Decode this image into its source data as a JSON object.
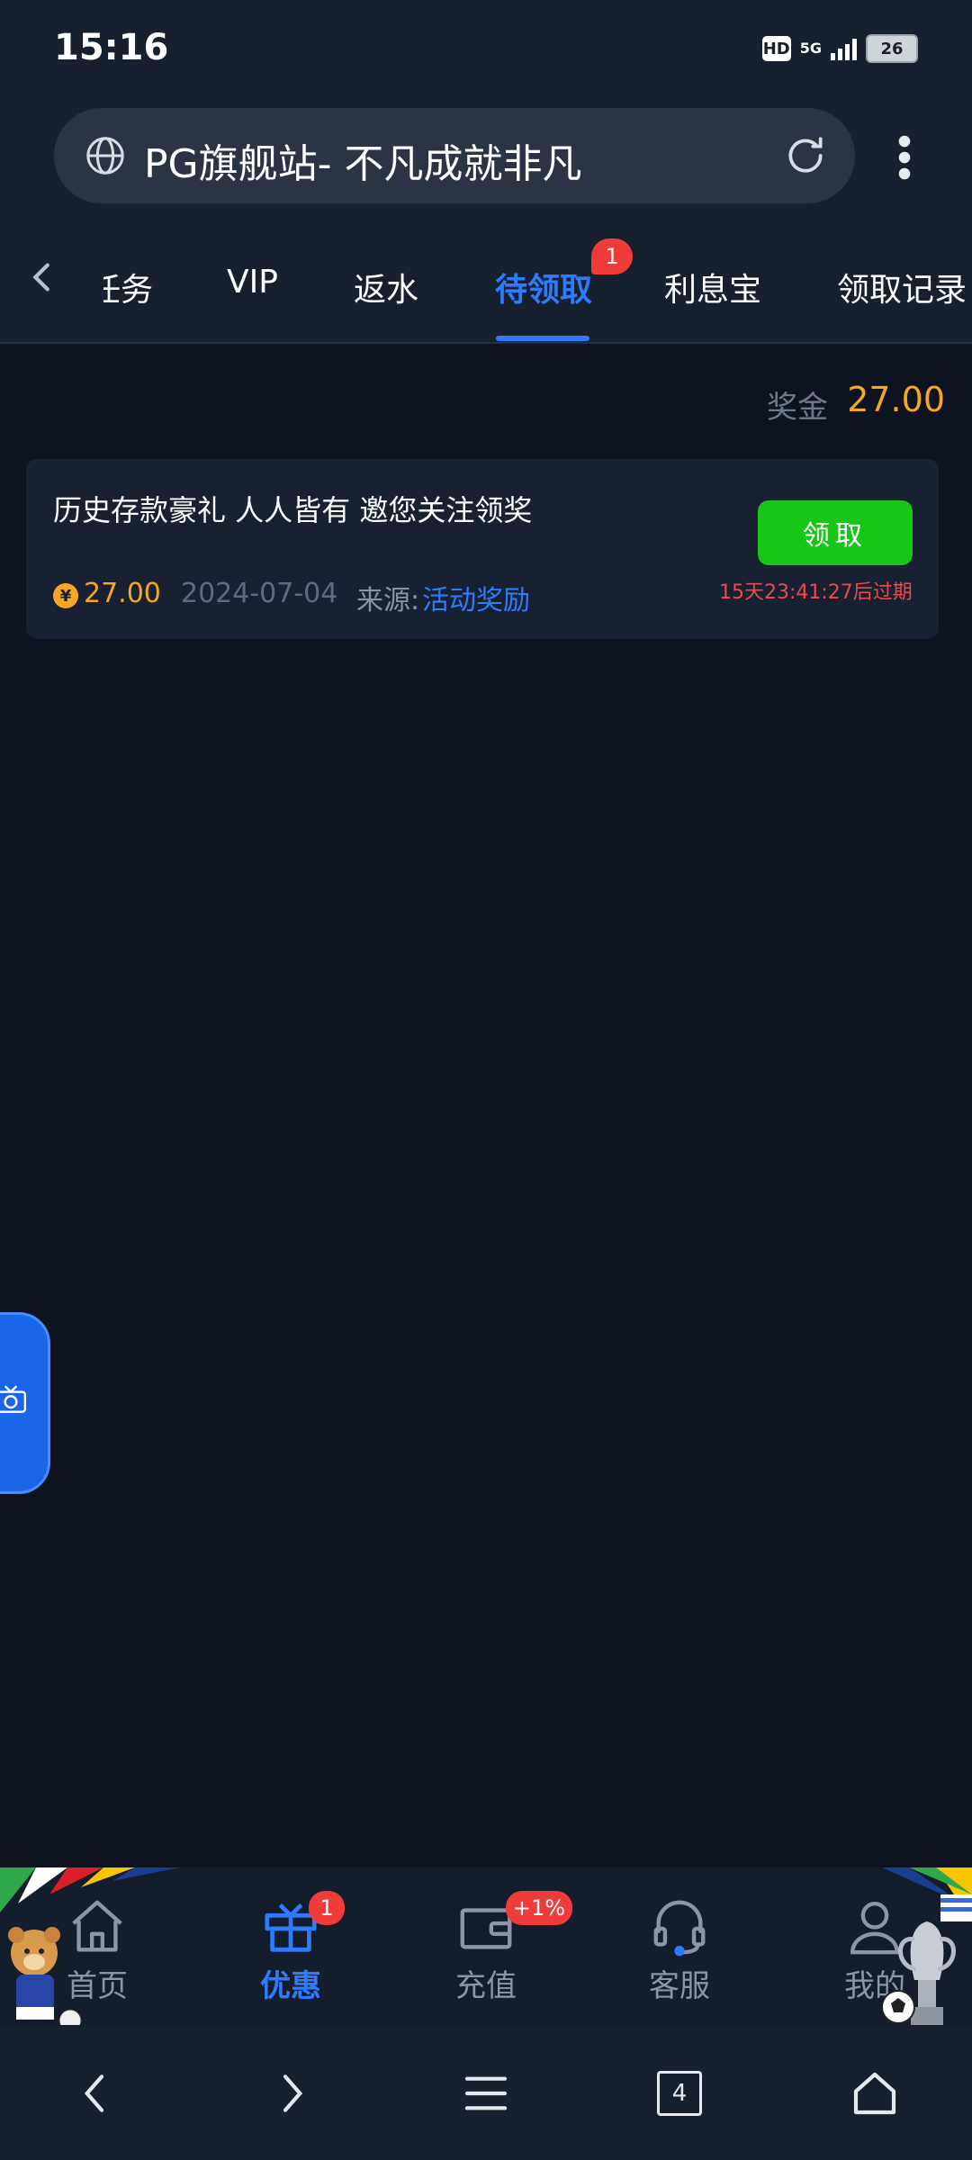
{
  "status": {
    "time": "15:16",
    "hd": "HD",
    "network": "5G",
    "battery": "26"
  },
  "browser": {
    "title": "PG旗舰站- 不凡成就非凡"
  },
  "tabs": [
    {
      "label": "任务"
    },
    {
      "label": "VIP"
    },
    {
      "label": "返水"
    },
    {
      "label": "待领取",
      "active": true,
      "badge": "1"
    },
    {
      "label": "利息宝"
    },
    {
      "label": "领取记录"
    }
  ],
  "bonus": {
    "label": "奖金",
    "value": "27.00"
  },
  "reward_card": {
    "title": "历史存款豪礼 人人皆有 邀您关注领奖",
    "button": "领取",
    "expire": "15天23:41:27后过期",
    "currency_symbol": "¥",
    "amount": "27.00",
    "date": "2024-07-04",
    "source_label": "来源:",
    "source_value": "活动奖励"
  },
  "bottom_nav": [
    {
      "label": "首页",
      "icon": "home-icon"
    },
    {
      "label": "优惠",
      "icon": "gift-icon",
      "active": true,
      "badge": "1"
    },
    {
      "label": "充值",
      "icon": "wallet-icon",
      "badge": "+1%"
    },
    {
      "label": "客服",
      "icon": "headset-icon"
    },
    {
      "label": "我的",
      "icon": "user-icon"
    }
  ],
  "system_nav": {
    "tab_count": "4"
  },
  "colors": {
    "accent": "#2f7bff",
    "gold": "#f5a623",
    "claim_green": "#17c617",
    "badge_red": "#f03b3b"
  }
}
